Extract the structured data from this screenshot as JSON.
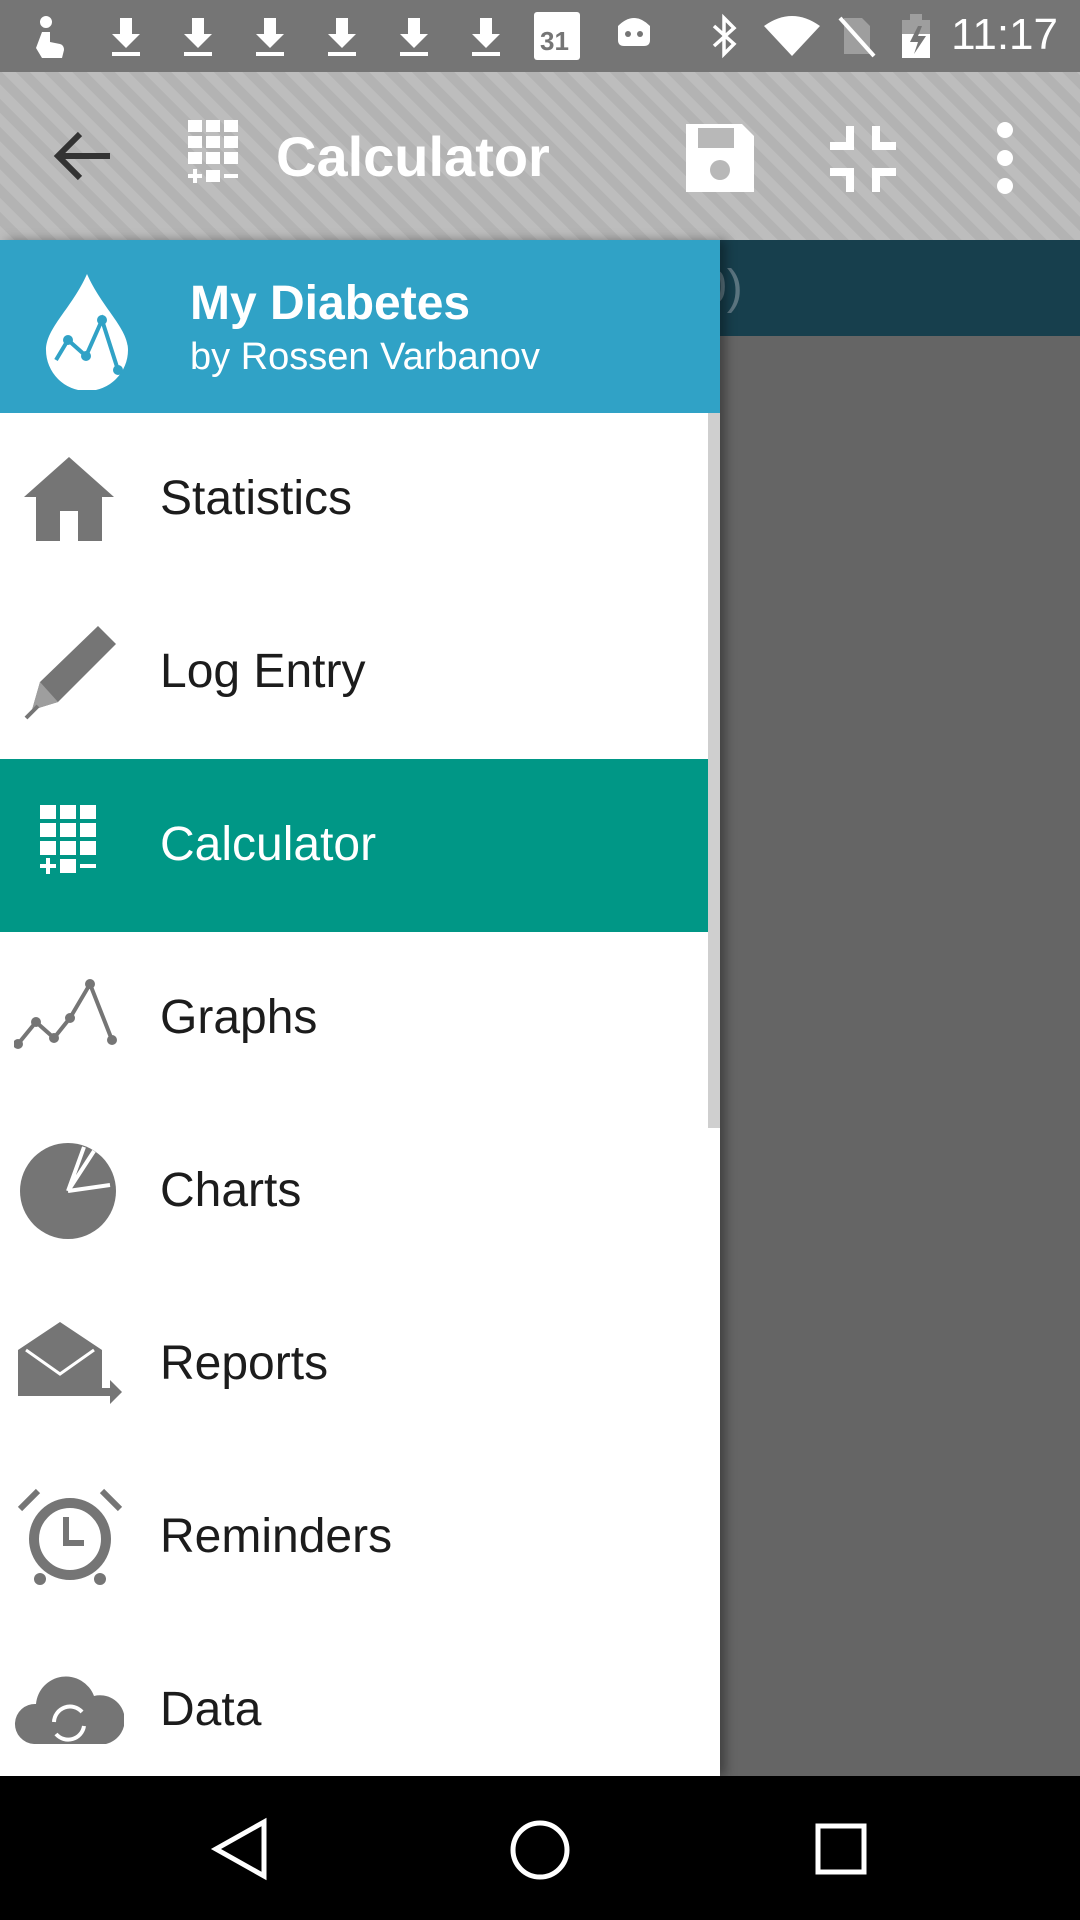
{
  "status_bar": {
    "time": "11:17",
    "calendar_day": "31",
    "icons": [
      "touch-icon",
      "download-icon",
      "download-icon",
      "download-icon",
      "download-icon",
      "download-icon",
      "download-icon",
      "calendar-icon",
      "android-icon",
      "bluetooth-icon",
      "wifi-icon",
      "no-sim-icon",
      "battery-charging-icon"
    ]
  },
  "app_bar": {
    "title": "Calculator",
    "actions": [
      "back-arrow-icon",
      "calculator-icon",
      "save-icon",
      "fullscreen-exit-icon",
      "more-vert-icon"
    ]
  },
  "content_peek": {
    "text": "0)"
  },
  "drawer": {
    "app_name": "My Diabetes",
    "author": "by Rossen Varbanov",
    "items": [
      {
        "label": "Statistics",
        "icon": "home-icon",
        "active": false
      },
      {
        "label": "Log Entry",
        "icon": "pencil-icon",
        "active": false
      },
      {
        "label": "Calculator",
        "icon": "calculator-icon",
        "active": true
      },
      {
        "label": "Graphs",
        "icon": "line-graph-icon",
        "active": false
      },
      {
        "label": "Charts",
        "icon": "pie-chart-icon",
        "active": false
      },
      {
        "label": "Reports",
        "icon": "mail-report-icon",
        "active": false
      },
      {
        "label": "Reminders",
        "icon": "alarm-clock-icon",
        "active": false
      },
      {
        "label": "Data",
        "icon": "cloud-sync-icon",
        "active": false
      }
    ]
  },
  "colors": {
    "drawer_header": "#30a2c6",
    "active_item": "#009786",
    "icon_gray": "#757575",
    "content_strip": "#173f4d"
  },
  "nav_bar": {
    "buttons": [
      "back-triangle-icon",
      "home-circle-icon",
      "recents-square-icon"
    ]
  }
}
